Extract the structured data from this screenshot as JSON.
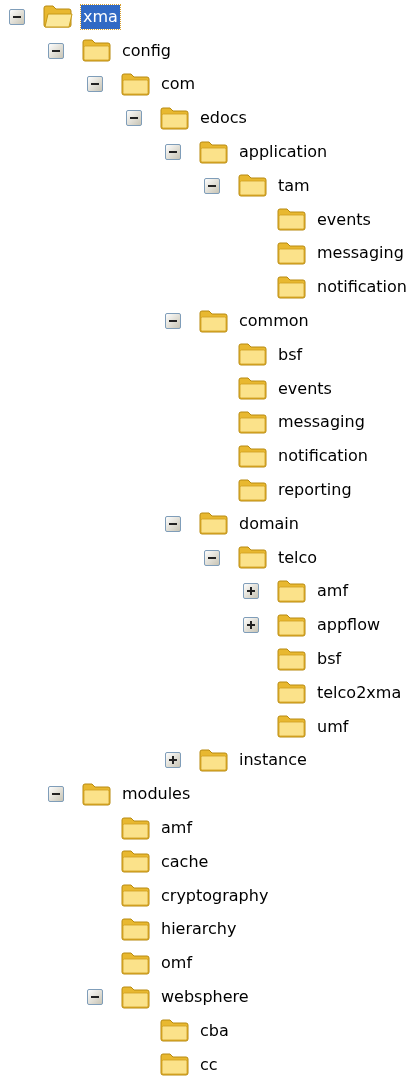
{
  "tree": [
    {
      "label": "xma",
      "selected": true,
      "expanded": true,
      "children": [
        {
          "label": "config",
          "selected": false,
          "expanded": true,
          "children": [
            {
              "label": "com",
              "selected": false,
              "expanded": true,
              "children": [
                {
                  "label": "edocs",
                  "selected": false,
                  "expanded": true,
                  "children": [
                    {
                      "label": "application",
                      "selected": false,
                      "expanded": true,
                      "children": [
                        {
                          "label": "tam",
                          "selected": false,
                          "expanded": true,
                          "children": [
                            {
                              "label": "events",
                              "selected": false
                            },
                            {
                              "label": "messaging",
                              "selected": false
                            },
                            {
                              "label": "notification",
                              "selected": false
                            }
                          ]
                        }
                      ]
                    },
                    {
                      "label": "common",
                      "selected": false,
                      "expanded": true,
                      "children": [
                        {
                          "label": "bsf",
                          "selected": false
                        },
                        {
                          "label": "events",
                          "selected": false
                        },
                        {
                          "label": "messaging",
                          "selected": false
                        },
                        {
                          "label": "notification",
                          "selected": false
                        },
                        {
                          "label": "reporting",
                          "selected": false
                        }
                      ]
                    },
                    {
                      "label": "domain",
                      "selected": false,
                      "expanded": true,
                      "children": [
                        {
                          "label": "telco",
                          "selected": false,
                          "expanded": true,
                          "children": [
                            {
                              "label": "amf",
                              "selected": false,
                              "expanded": false
                            },
                            {
                              "label": "appflow",
                              "selected": false,
                              "expanded": false
                            },
                            {
                              "label": "bsf",
                              "selected": false
                            },
                            {
                              "label": "telco2xma",
                              "selected": false
                            },
                            {
                              "label": "umf",
                              "selected": false
                            }
                          ]
                        }
                      ]
                    },
                    {
                      "label": "instance",
                      "selected": false,
                      "expanded": false
                    }
                  ]
                }
              ]
            }
          ]
        },
        {
          "label": "modules",
          "selected": false,
          "expanded": true,
          "children": [
            {
              "label": "amf",
              "selected": false
            },
            {
              "label": "cache",
              "selected": false
            },
            {
              "label": "cryptography",
              "selected": false
            },
            {
              "label": "hierarchy",
              "selected": false
            },
            {
              "label": "omf",
              "selected": false
            },
            {
              "label": "websphere",
              "selected": false,
              "expanded": true,
              "children": [
                {
                  "label": "cba",
                  "selected": false
                },
                {
                  "label": "cc",
                  "selected": false
                }
              ]
            }
          ]
        }
      ]
    }
  ]
}
